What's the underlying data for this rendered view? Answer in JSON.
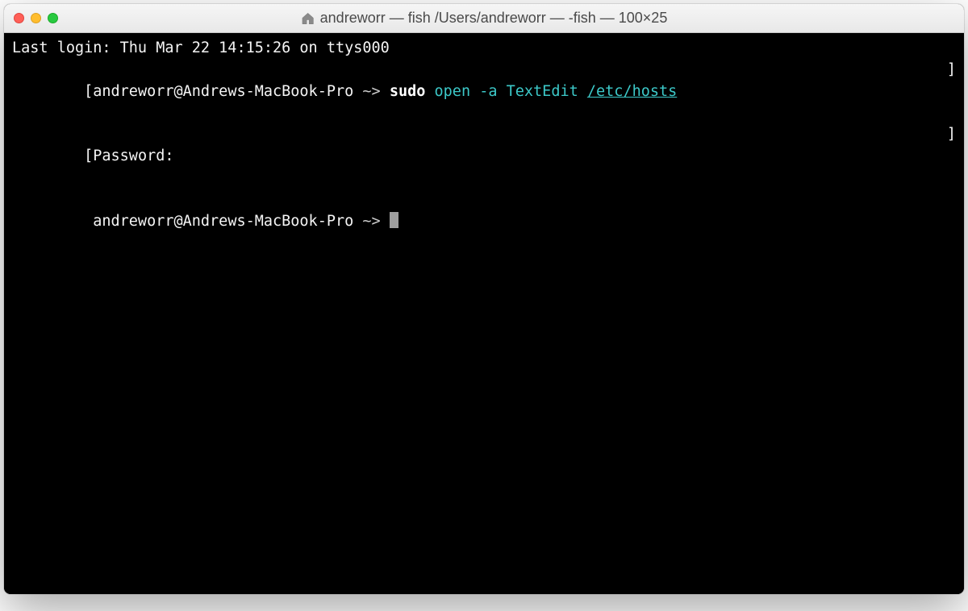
{
  "window": {
    "title": "andreworr — fish  /Users/andreworr — -fish — 100×25"
  },
  "terminal": {
    "last_login": "Last login: Thu Mar 22 14:15:26 on ttys000",
    "line1": {
      "bracket_open": "[",
      "prompt": "andreworr@Andrews-MacBook-Pro",
      "sep": " ~> ",
      "cmd_sudo": "sudo",
      "cmd_rest1": " open -a TextEdit ",
      "cmd_path": "/etc/hosts",
      "bracket_close": "]"
    },
    "line2": {
      "bracket_open": "[",
      "text": "Password:",
      "bracket_close": "]"
    },
    "line3": {
      "prompt": " andreworr@Andrews-MacBook-Pro",
      "sep": " ~> "
    }
  }
}
